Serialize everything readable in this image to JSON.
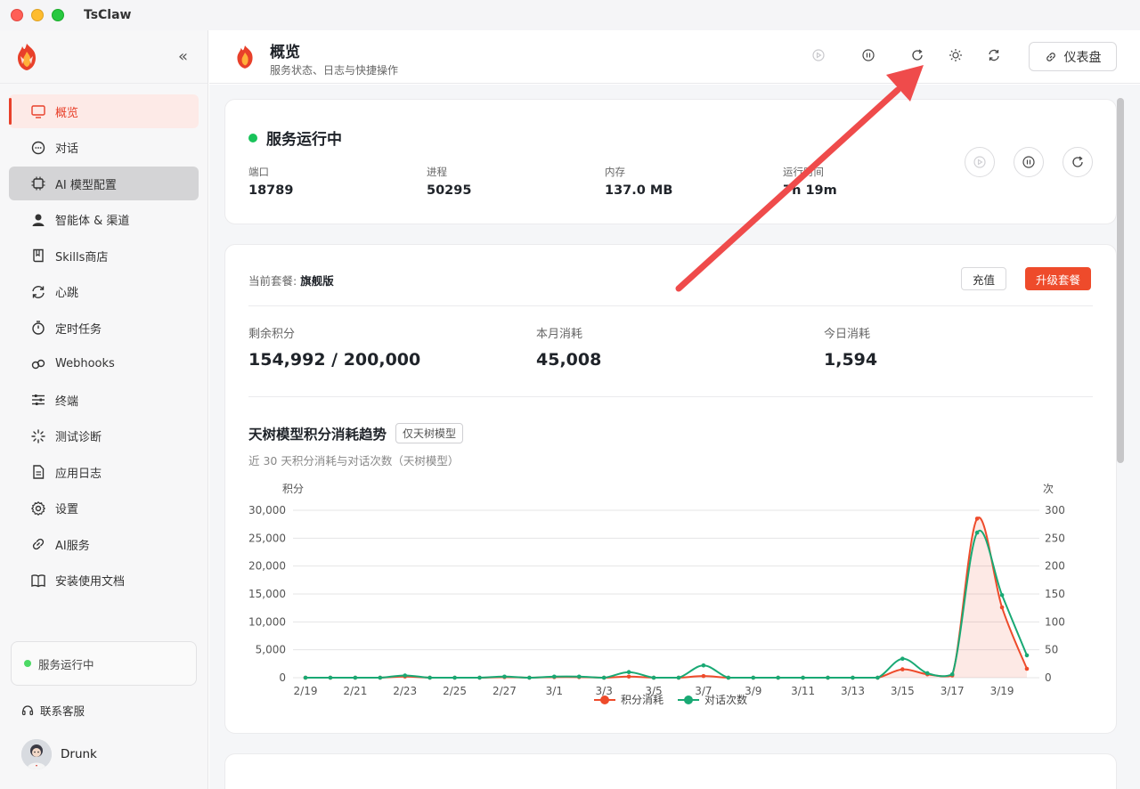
{
  "window": {
    "title": "TsClaw"
  },
  "sidebar": {
    "items": [
      {
        "label": "概览",
        "icon": "monitor-icon",
        "active": true
      },
      {
        "label": "对话",
        "icon": "chat-icon"
      },
      {
        "label": "AI 模型配置",
        "icon": "chip-icon",
        "hover": true
      },
      {
        "label": "智能体 & 渠道",
        "icon": "user-icon"
      },
      {
        "label": "Skills商店",
        "icon": "book-icon"
      },
      {
        "label": "心跳",
        "icon": "refresh-icon"
      },
      {
        "label": "定时任务",
        "icon": "timer-icon"
      },
      {
        "label": "Webhooks",
        "icon": "webhook-icon"
      },
      {
        "label": "终端",
        "icon": "sliders-icon"
      },
      {
        "label": "测试诊断",
        "icon": "loader-icon"
      },
      {
        "label": "应用日志",
        "icon": "file-icon"
      },
      {
        "label": "设置",
        "icon": "gear-icon"
      },
      {
        "label": "AI服务",
        "icon": "link-icon"
      },
      {
        "label": "安装使用文档",
        "icon": "open-book-icon"
      }
    ],
    "service_status": "服务运行中",
    "support": "联系客服",
    "user_name": "Drunk"
  },
  "header": {
    "title": "概览",
    "subtitle": "服务状态、日志与快捷操作",
    "dashboard_label": "仪表盘"
  },
  "status_card": {
    "title": "服务运行中",
    "stats": [
      {
        "label": "端口",
        "value": "18789"
      },
      {
        "label": "进程",
        "value": "50295"
      },
      {
        "label": "内存",
        "value": "137.0 MB"
      },
      {
        "label": "运行时间",
        "value": "7h 19m"
      }
    ]
  },
  "plan_card": {
    "plan_label": "当前套餐:",
    "plan_value": "旗舰版",
    "recharge_label": "充值",
    "upgrade_label": "升级套餐",
    "metrics": [
      {
        "label": "剩余积分",
        "value": "154,992 / 200,000"
      },
      {
        "label": "本月消耗",
        "value": "45,008"
      },
      {
        "label": "今日消耗",
        "value": "1,594"
      }
    ],
    "chart_title": "天树模型积分消耗趋势",
    "chart_tag": "仅天树模型",
    "chart_subtitle": "近 30 天积分消耗与对话次数（天树模型）"
  },
  "chart_data": {
    "type": "line",
    "x": [
      "2/19",
      "2/20",
      "2/21",
      "2/22",
      "2/23",
      "2/24",
      "2/25",
      "2/26",
      "2/27",
      "2/28",
      "3/1",
      "3/2",
      "3/3",
      "3/4",
      "3/5",
      "3/6",
      "3/7",
      "3/8",
      "3/9",
      "3/10",
      "3/11",
      "3/12",
      "3/13",
      "3/14",
      "3/15",
      "3/16",
      "3/17",
      "3/18",
      "3/19",
      "3/20"
    ],
    "x_tick_labels": [
      "2/19",
      "2/21",
      "2/23",
      "2/25",
      "2/27",
      "3/1",
      "3/3",
      "3/5",
      "3/7",
      "3/9",
      "3/11",
      "3/13",
      "3/15",
      "3/17",
      "3/19"
    ],
    "ylabel_left": "积分",
    "ylabel_right": "次",
    "ylim_left": [
      0,
      30000
    ],
    "ylim_right": [
      0,
      300
    ],
    "yticks_left": [
      "30,000",
      "25,000",
      "20,000",
      "15,000",
      "10,000",
      "5,000",
      "0"
    ],
    "yticks_right": [
      "300",
      "250",
      "200",
      "150",
      "100",
      "50",
      "0"
    ],
    "series": [
      {
        "name": "积分消耗",
        "axis": "left",
        "color": "#ee4b2b",
        "area": true,
        "values": [
          0,
          0,
          0,
          0,
          200,
          0,
          0,
          0,
          100,
          0,
          100,
          100,
          0,
          200,
          0,
          0,
          300,
          0,
          0,
          0,
          0,
          0,
          0,
          0,
          1500,
          600,
          400,
          28500,
          12600,
          1594
        ]
      },
      {
        "name": "对话次数",
        "axis": "right",
        "color": "#19a974",
        "area": false,
        "values": [
          0,
          0,
          0,
          0,
          4,
          0,
          0,
          0,
          2,
          0,
          2,
          2,
          0,
          10,
          0,
          0,
          22,
          0,
          0,
          0,
          0,
          0,
          0,
          0,
          34,
          8,
          6,
          260,
          148,
          40
        ]
      }
    ],
    "legend": "bottom-center"
  }
}
